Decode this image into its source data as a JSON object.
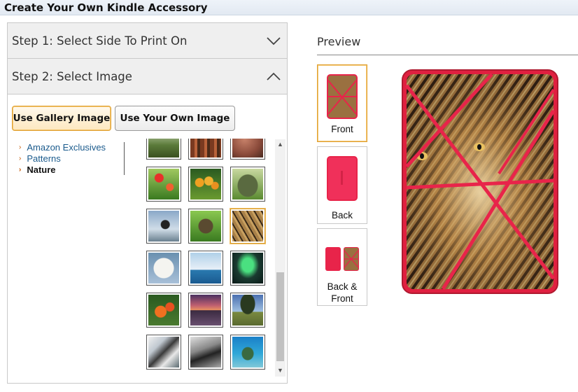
{
  "title": "Create Your Own Kindle Accessory",
  "steps": [
    {
      "label": "Step 1: Select Side To Print On",
      "state": "collapsed"
    },
    {
      "label": "Step 2: Select Image",
      "state": "expanded"
    }
  ],
  "buttons": {
    "gallery": "Use Gallery Image",
    "own": "Use Your Own Image"
  },
  "categories": [
    "Amazon Exclusives",
    "Patterns",
    "Nature"
  ],
  "selected_category": "Nature",
  "preview": {
    "title": "Preview",
    "options": [
      "Front",
      "Back",
      "Back & Front"
    ],
    "selected": "Front"
  },
  "colors": {
    "accent": "#e0a030",
    "link": "#1a5a8c",
    "cover_red": "#e8244a"
  },
  "icons": {
    "step1_toggle": "chevron-down-icon",
    "step2_toggle": "chevron-up-icon"
  }
}
